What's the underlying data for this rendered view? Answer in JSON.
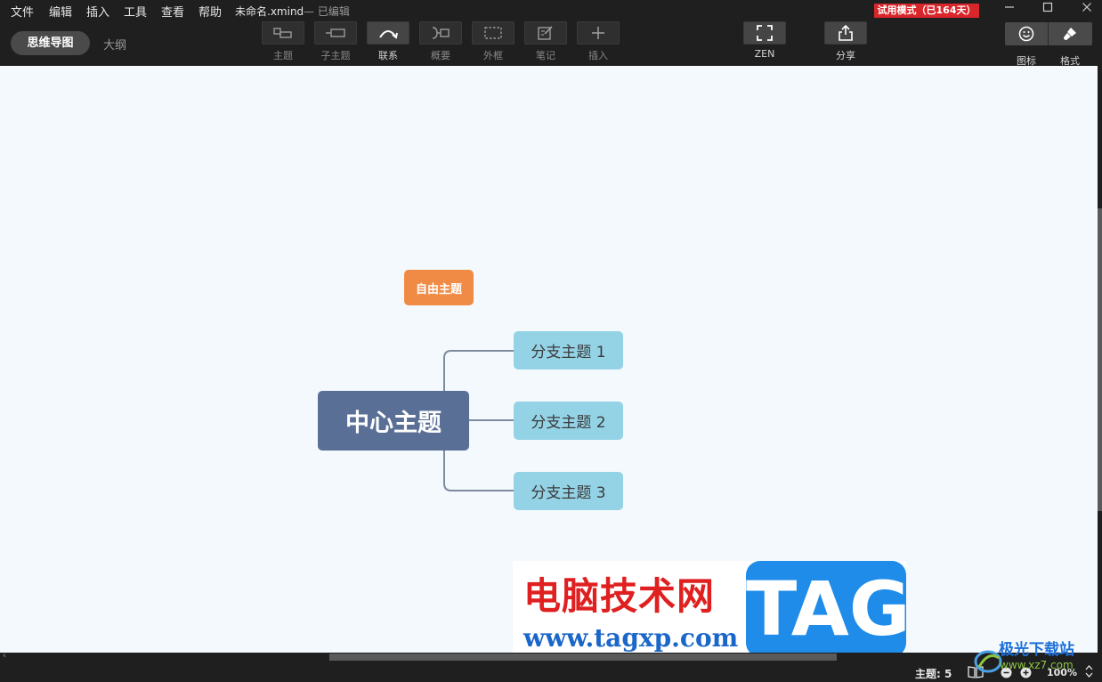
{
  "menu": {
    "items": [
      "文件",
      "编辑",
      "插入",
      "工具",
      "查看",
      "帮助"
    ]
  },
  "file": {
    "name": "未命名.xmind",
    "status": "— 已编辑"
  },
  "trial": {
    "label": "试用模式（已164天）"
  },
  "view": {
    "mindmap": "思维导图",
    "outline": "大纲"
  },
  "toolbar": {
    "topic": "主题",
    "subtopic": "子主题",
    "relationship": "联系",
    "summary": "概要",
    "boundary": "外框",
    "note": "笔记",
    "insert": "插入",
    "zen": "ZEN",
    "share": "分享",
    "icon": "图标",
    "format": "格式"
  },
  "map": {
    "central": "中心主题",
    "floating": "自由主题",
    "branches": [
      "分支主题 1",
      "分支主题 2",
      "分支主题 3"
    ]
  },
  "watermark": {
    "site_cn": "电脑技术网",
    "url": "www.tagxp.com",
    "tag": "TAG",
    "logo_cn": "极光下载站",
    "logo_en": "www.xz7.com"
  },
  "status": {
    "topic_count": "主题: 5",
    "zoom": "100%"
  },
  "colors": {
    "central": "#5a6f96",
    "branch": "#94d3e6",
    "floating": "#f08b45",
    "trial": "#d8262b"
  }
}
